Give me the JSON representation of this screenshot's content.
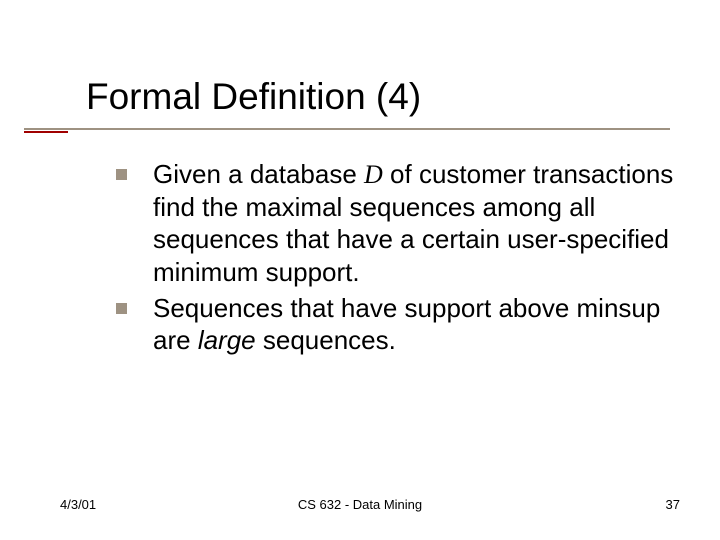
{
  "title": "Formal Definition (4)",
  "bullets": [
    {
      "pre": "Given a database ",
      "math": "D",
      "post": " of customer transactions find the maximal sequences among all sequences that have a certain user-specified minimum support."
    },
    {
      "pre": "Sequences that have support above minsup are ",
      "italic": "large",
      "post": " sequences."
    }
  ],
  "footer": {
    "date": "4/3/01",
    "course": "CS 632 - Data Mining",
    "page": "37"
  }
}
